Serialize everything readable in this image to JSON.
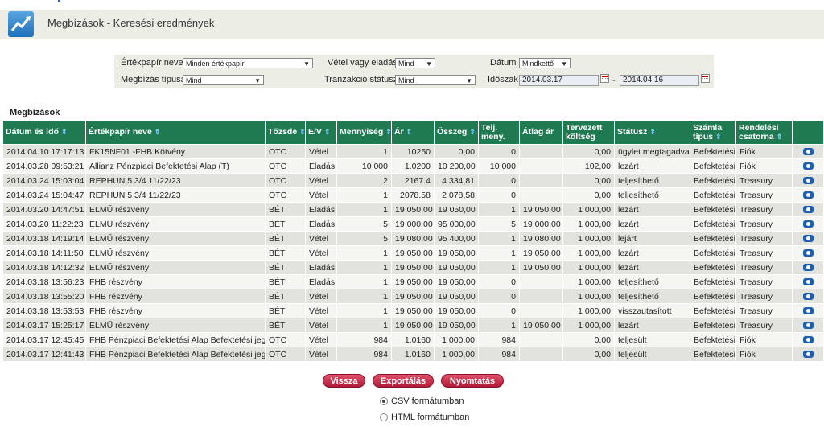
{
  "header": {
    "title": "Megbízások - Keresési eredmények",
    "logo_icon": "chart-trend-icon"
  },
  "filters": {
    "security_label": "Értékpapír neve",
    "security_value": "Minden értékpapír",
    "buy_sell_label": "Vétel vagy eladás",
    "buy_sell_value": "Mind",
    "date_label": "Dátum",
    "date_value": "Mindkettő",
    "order_type_label": "Megbízás típusa",
    "order_type_value": "Mind",
    "tx_status_label": "Tranzakció státusz",
    "tx_status_value": "Mind",
    "period_label": "Időszak",
    "period_from": "2014.03.17",
    "period_sep": "-",
    "period_to": "2014.04.16"
  },
  "section_title": "Megbízások",
  "table": {
    "headers": [
      "Dátum és idő",
      "Értékpapír neve",
      "Tőzsde",
      "E/V",
      "Mennyiség",
      "Ár",
      "Összeg",
      "Telj. meny.",
      "Átlag ár",
      "Tervezett költség",
      "Státusz",
      "Számla típus",
      "Rendelési csatorna",
      ""
    ],
    "rows": [
      [
        "2014.04.10 17:17:13",
        "FK15NF01 -FHB Kötvény",
        "OTC",
        "Vétel",
        "1",
        "10250",
        "0,00",
        "0",
        "",
        "0,00",
        "ügylet megtagadva",
        "Befektetési",
        "Fiók"
      ],
      [
        "2014.03.28 09:53:21",
        "Allianz Pénzpiaci Befektetési Alap (T)",
        "OTC",
        "Eladás",
        "10 000",
        "1.0200",
        "10 200,00",
        "10 000",
        "",
        "102,00",
        "lezárt",
        "Befektetési",
        "Fiók"
      ],
      [
        "2014.03.24 15:03:04",
        "REPHUN 5 3/4 11/22/23",
        "OTC",
        "Vétel",
        "2",
        "2167.4",
        "4 334,81",
        "0",
        "",
        "0,00",
        "teljesíthető",
        "Befektetési",
        "Treasury"
      ],
      [
        "2014.03.24 15:04:47",
        "REPHUN 5 3/4 11/22/23",
        "OTC",
        "Vétel",
        "1",
        "2078.58",
        "2 078,58",
        "0",
        "",
        "0,00",
        "teljesíthető",
        "Befektetési",
        "Treasury"
      ],
      [
        "2014.03.20 14:47:51",
        "ELMŰ részvény",
        "BÉT",
        "Eladás",
        "1",
        "19 050,00",
        "19 050,00",
        "1",
        "19 050,00",
        "1 000,00",
        "lezárt",
        "Befektetési",
        "Treasury"
      ],
      [
        "2014.03.20 11:22:23",
        "ELMŰ részvény",
        "BÉT",
        "Eladás",
        "5",
        "19 000,00",
        "95 000,00",
        "5",
        "19 000,00",
        "1 000,00",
        "lezárt",
        "Befektetési",
        "Treasury"
      ],
      [
        "2014.03.18 14:19:14",
        "ELMŰ részvény",
        "BÉT",
        "Vétel",
        "5",
        "19 080,00",
        "95 400,00",
        "1",
        "19 080,00",
        "1 000,00",
        "lejárt",
        "Befektetési",
        "Treasury"
      ],
      [
        "2014.03.18 14:11:50",
        "ELMŰ részvény",
        "BÉT",
        "Vétel",
        "1",
        "19 050,00",
        "19 050,00",
        "1",
        "19 050,00",
        "1 000,00",
        "lezárt",
        "Befektetési",
        "Treasury"
      ],
      [
        "2014.03.18 14:12:32",
        "ELMŰ részvény",
        "BÉT",
        "Eladás",
        "1",
        "19 050,00",
        "19 050,00",
        "1",
        "19 050,00",
        "1 000,00",
        "lezárt",
        "Befektetési",
        "Treasury"
      ],
      [
        "2014.03.18 13:56:23",
        "FHB részvény",
        "BÉT",
        "Eladás",
        "1",
        "19 050,00",
        "19 050,00",
        "0",
        "",
        "1 000,00",
        "teljesíthető",
        "Befektetési",
        "Treasury"
      ],
      [
        "2014.03.18 13:55:20",
        "FHB részvény",
        "BÉT",
        "Vétel",
        "1",
        "19 050,00",
        "19 050,00",
        "0",
        "",
        "1 000,00",
        "teljesíthető",
        "Befektetési",
        "Treasury"
      ],
      [
        "2014.03.18 13:53:53",
        "FHB részvény",
        "BÉT",
        "Vétel",
        "1",
        "19 050,00",
        "19 050,00",
        "0",
        "",
        "1 000,00",
        "visszautasított",
        "Befektetési",
        "Treasury"
      ],
      [
        "2014.03.17 15:25:17",
        "ELMŰ részvény",
        "BÉT",
        "Vétel",
        "1",
        "19 050,00",
        "19 050,00",
        "1",
        "19 050,00",
        "1 000,00",
        "lezárt",
        "Befektetési",
        "Treasury"
      ],
      [
        "2014.03.17 12:45:45",
        "FHB Pénzpiaci Befektetési Alap Befektetési jegy",
        "OTC",
        "Vétel",
        "984",
        "1.0160",
        "1 000,00",
        "984",
        "",
        "0,00",
        "teljesült",
        "Befektetési",
        "Fiók"
      ],
      [
        "2014.03.17 12:41:43",
        "FHB Pénzpiaci Befektetési Alap Befektetési jegy",
        "OTC",
        "Vétel",
        "984",
        "1.0160",
        "1 000,00",
        "984",
        "",
        "0,00",
        "teljesült",
        "Befektetési",
        "Fiók"
      ]
    ]
  },
  "buttons": {
    "back": "Vissza",
    "export": "Exportálás",
    "print": "Nyomtatás"
  },
  "export_format": {
    "csv": "CSV formátumban",
    "html": "HTML formátumban",
    "selected": "csv"
  },
  "colors": {
    "header_bg": "#1f7a52",
    "button": "#c0243f"
  }
}
